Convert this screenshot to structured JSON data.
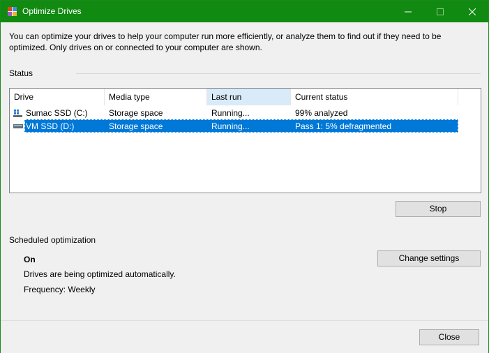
{
  "window": {
    "title": "Optimize Drives"
  },
  "intro_text": "You can optimize your drives to help your computer run more efficiently, or analyze them to find out if they need to be optimized. Only drives on or connected to your computer are shown.",
  "status_section": {
    "label": "Status",
    "columns": [
      "Drive",
      "Media type",
      "Last run",
      "Current status"
    ],
    "drives": [
      {
        "name": "Sumac SSD (C:)",
        "media_type": "Storage space",
        "last_run": "Running...",
        "current_status": "99% analyzed",
        "icon": "windows-drive-icon",
        "selected": false
      },
      {
        "name": "VM SSD (D:)",
        "media_type": "Storage space",
        "last_run": "Running...",
        "current_status": "Pass 1: 5% defragmented",
        "icon": "drive-icon",
        "selected": true
      }
    ],
    "stop_label": "Stop"
  },
  "scheduled": {
    "label": "Scheduled optimization",
    "state": "On",
    "description": "Drives are being optimized automatically.",
    "frequency": "Frequency: Weekly",
    "change_settings_label": "Change settings"
  },
  "footer": {
    "close_label": "Close"
  },
  "colors": {
    "titlebar": "#118a11",
    "selection": "#0078d7",
    "sorted_header": "#d9ebf9"
  }
}
